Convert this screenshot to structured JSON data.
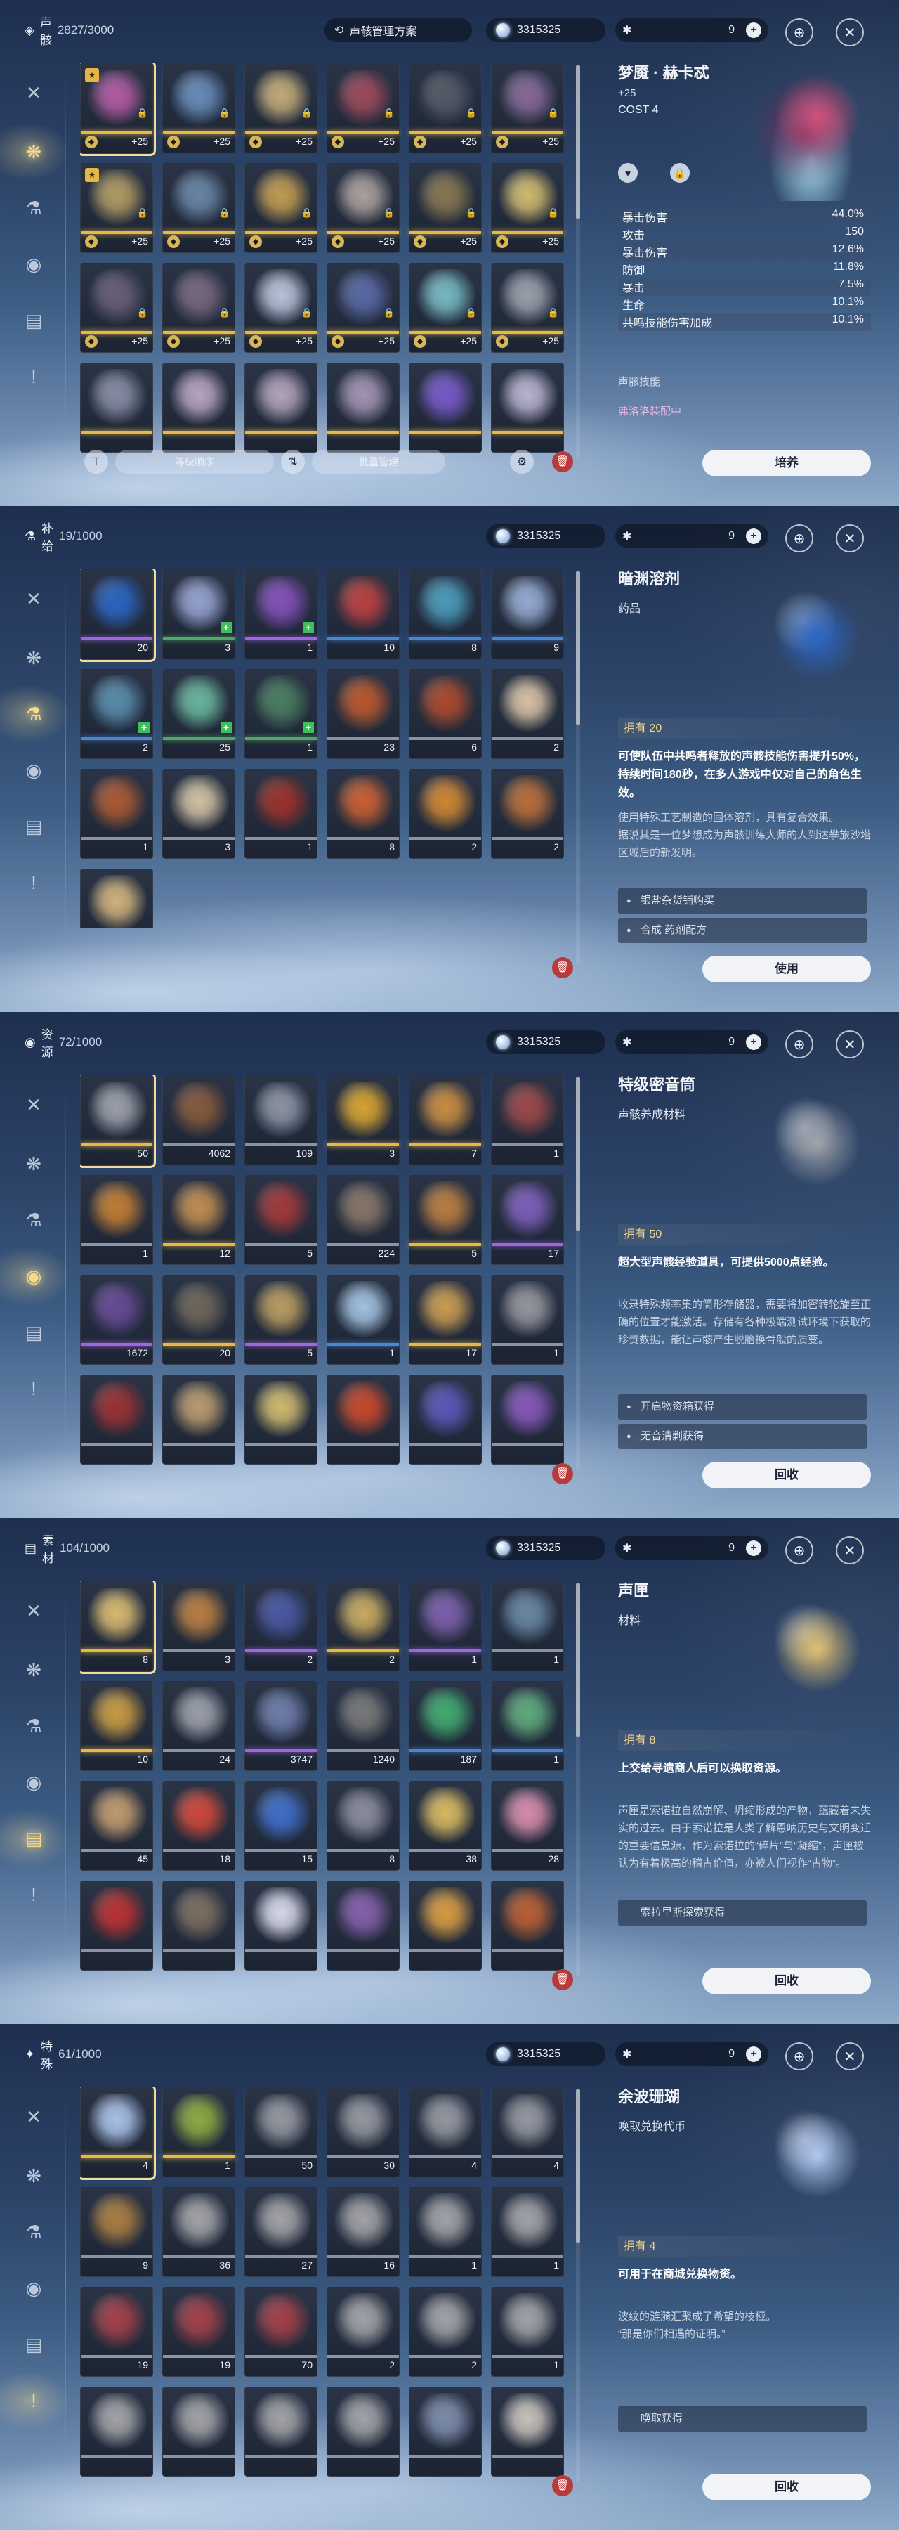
{
  "currency": "3315325",
  "stamina": "9",
  "panels": [
    {
      "cat_name": "声骸",
      "cat_count": "2827/3000",
      "cat_icon": "◈",
      "top_btn": "声骸管理方案",
      "sort_label": "等级顺序",
      "batch_label": "批量管理",
      "detail": {
        "name": "梦魇 · 赫卡忒",
        "level": "+25",
        "cost": "COST  4",
        "stats": [
          [
            "暴击伤害",
            "44.0%"
          ],
          [
            "攻击",
            "150"
          ],
          [
            "暴击伤害",
            "12.6%"
          ],
          [
            "防御",
            "11.8%"
          ],
          [
            "暴击",
            "7.5%"
          ],
          [
            "生命",
            "10.1%"
          ],
          [
            "共鸣技能伤害加成",
            "10.1%"
          ]
        ],
        "skill": "声骸技能",
        "set": "弗洛洛装配中",
        "button": "培养"
      },
      "items": [
        {
          "c": "4",
          "q": "q5",
          "b": "+25",
          "col": "#b85ca8"
        },
        {
          "c": "4",
          "q": "q5",
          "b": "+25",
          "col": "#6a8fbf"
        },
        {
          "c": "4",
          "q": "q5",
          "b": "+25",
          "col": "#c9b07a"
        },
        {
          "c": "4",
          "q": "q5",
          "b": "+25",
          "col": "#a04a5a"
        },
        {
          "c": "4",
          "q": "q5",
          "b": "+25",
          "col": "#555a66"
        },
        {
          "c": "4",
          "q": "q5",
          "b": "+25",
          "col": "#8a6a9a"
        },
        {
          "c": "4",
          "q": "q5",
          "b": "+25",
          "col": "#b8a064"
        },
        {
          "c": "4",
          "q": "q5",
          "b": "+25",
          "col": "#6a88a8"
        },
        {
          "c": "4",
          "q": "q5",
          "b": "+25",
          "col": "#c8a050"
        },
        {
          "c": "4",
          "q": "q5",
          "b": "+25",
          "col": "#b0a4a0"
        },
        {
          "c": "4",
          "q": "q5",
          "b": "+25",
          "col": "#8a7850"
        },
        {
          "c": "4",
          "q": "q5",
          "b": "+25",
          "col": "#d8c070"
        },
        {
          "c": "4",
          "q": "q5",
          "b": "+25",
          "col": "#6a6078"
        },
        {
          "c": "4",
          "q": "q5",
          "b": "+25",
          "col": "#7a6a80"
        },
        {
          "c": "4",
          "q": "q5",
          "b": "+25",
          "col": "#c0c8e0"
        },
        {
          "c": "4",
          "q": "q5",
          "b": "+25",
          "col": "#5a6aa8"
        },
        {
          "c": "4",
          "q": "q5",
          "b": "+25",
          "col": "#7ac0c8"
        },
        {
          "c": "4",
          "q": "q5",
          "b": "+25",
          "col": "#a0a4b0"
        },
        {
          "c": "",
          "q": "q5",
          "b": "",
          "col": "#8a90a8"
        },
        {
          "c": "",
          "q": "q5",
          "b": "",
          "col": "#c0a8c8"
        },
        {
          "c": "",
          "q": "q5",
          "b": "",
          "col": "#b8a8c0"
        },
        {
          "c": "",
          "q": "q5",
          "b": "",
          "col": "#a898b8"
        },
        {
          "c": "",
          "q": "q5",
          "b": "",
          "col": "#7a5ad0"
        },
        {
          "c": "",
          "q": "q5",
          "b": "",
          "col": "#c0b8d8"
        }
      ]
    },
    {
      "cat_name": "补给",
      "cat_count": "19/1000",
      "cat_icon": "⚗",
      "detail": {
        "name": "暗渊溶剂",
        "type": "药品",
        "own": "拥有 20",
        "desc1": "可使队伍中共鸣者释放的声骸技能伤害提升50%，持续时间180秒，在多人游戏中仅对自己的角色生效。",
        "desc2": "使用特殊工艺制造的固体溶剂，具有复合效果。\n据说其是一位梦想成为声骸训练大师的人到达攀旅沙塔区域后的新发明。",
        "sources": [
          "银盐杂货铺购买",
          "合成 药剂配方"
        ],
        "button": "使用"
      },
      "items": [
        {
          "c": "20",
          "q": "q4",
          "col": "#2a66c8"
        },
        {
          "c": "3",
          "q": "q2",
          "col": "#9aa8d8"
        },
        {
          "c": "1",
          "q": "q4",
          "col": "#8850c0"
        },
        {
          "c": "10",
          "q": "q3",
          "col": "#c04040"
        },
        {
          "c": "8",
          "q": "q3",
          "col": "#4aa0c0"
        },
        {
          "c": "9",
          "q": "q3",
          "col": "#9ab0d8"
        },
        {
          "c": "2",
          "q": "q3",
          "col": "#5a90b0"
        },
        {
          "c": "25",
          "q": "q2",
          "col": "#6abca0"
        },
        {
          "c": "1",
          "q": "q2",
          "col": "#4a8060"
        },
        {
          "c": "23",
          "q": "q1",
          "col": "#c0582a"
        },
        {
          "c": "6",
          "q": "q1",
          "col": "#b04a2a"
        },
        {
          "c": "2",
          "q": "q1",
          "col": "#e0c8a8"
        },
        {
          "c": "1",
          "q": "q1",
          "col": "#b05a30"
        },
        {
          "c": "3",
          "q": "q1",
          "col": "#d8c8a8"
        },
        {
          "c": "1",
          "q": "q1",
          "col": "#a03028"
        },
        {
          "c": "8",
          "q": "q1",
          "col": "#d06030"
        },
        {
          "c": "2",
          "q": "q1",
          "col": "#d88a30"
        },
        {
          "c": "2",
          "q": "q1",
          "col": "#c07038"
        },
        {
          "c": "",
          "q": "q1",
          "col": "#d8b880"
        }
      ]
    },
    {
      "cat_name": "资源",
      "cat_count": "72/1000",
      "cat_icon": "◉",
      "detail": {
        "name": "特级密音筒",
        "type": "声骸养成材料",
        "own": "拥有 50",
        "desc1": "超大型声骸经验道具，可提供5000点经验。",
        "desc2": "收录特殊频率集的筒形存储器，需要将加密转轮旋至正确的位置才能激活。存储有各种极端测试环境下获取的珍贵数据，能让声骸产生脱胎换骨般的质变。",
        "sources": [
          "开启物资箱获得",
          "无音清剿获得"
        ],
        "button": "回收"
      },
      "items": [
        {
          "c": "50",
          "q": "q5",
          "col": "#a0a4ac"
        },
        {
          "c": "4062",
          "q": "q1",
          "col": "#8a5a3a"
        },
        {
          "c": "109",
          "q": "q1",
          "col": "#9098a8"
        },
        {
          "c": "3",
          "q": "q5",
          "col": "#e0a830"
        },
        {
          "c": "7",
          "q": "q5",
          "col": "#d09040"
        },
        {
          "c": "1",
          "q": "q1",
          "col": "#a04848"
        },
        {
          "c": "1",
          "q": "q1",
          "col": "#c88030"
        },
        {
          "c": "12",
          "q": "q5",
          "col": "#c89050"
        },
        {
          "c": "5",
          "q": "q1",
          "col": "#a83838"
        },
        {
          "c": "224",
          "q": "q1",
          "col": "#8a7868"
        },
        {
          "c": "5",
          "q": "q5",
          "col": "#c08040"
        },
        {
          "c": "17",
          "q": "q4",
          "col": "#8060c0"
        },
        {
          "c": "1672",
          "q": "q4",
          "col": "#6a4a9a"
        },
        {
          "c": "20",
          "q": "q5",
          "col": "#706858"
        },
        {
          "c": "5",
          "q": "q4",
          "col": "#c0a060"
        },
        {
          "c": "1",
          "q": "q3",
          "col": "#a8c8e8"
        },
        {
          "c": "17",
          "q": "q5",
          "col": "#d0a050"
        },
        {
          "c": "1",
          "q": "q1",
          "col": "#9a9aa0"
        },
        {
          "c": "",
          "q": "q1",
          "col": "#a03030"
        },
        {
          "c": "",
          "q": "q1",
          "col": "#c0a070"
        },
        {
          "c": "",
          "q": "q1",
          "col": "#d8c070"
        },
        {
          "c": "",
          "q": "q1",
          "col": "#d04828"
        },
        {
          "c": "",
          "q": "q1",
          "col": "#5a58c0"
        },
        {
          "c": "",
          "q": "q1",
          "col": "#8a58c0"
        }
      ]
    },
    {
      "cat_name": "素材",
      "cat_count": "104/1000",
      "cat_icon": "▤",
      "detail": {
        "name": "声匣",
        "type": "材料",
        "own": "拥有 8",
        "desc1": "上交给寻遗商人后可以换取资源。",
        "desc2": "声匣是索诺拉自然崩解、坍缩形成的产物，蕴藏着未失实的过去。由于索诺拉是人类了解恩呐历史与文明变迁的重要信息源，作为索诺拉的“碎片”与“凝缩”，声匣被认为有着极高的稽古价值，亦被人们视作“古物”。",
        "sources": [
          "索拉里斯探索获得"
        ],
        "button": "回收"
      },
      "items": [
        {
          "c": "8",
          "q": "q5",
          "col": "#e0c070"
        },
        {
          "c": "3",
          "q": "q1",
          "col": "#c08040"
        },
        {
          "c": "2",
          "q": "q4",
          "col": "#4a58a8"
        },
        {
          "c": "2",
          "q": "q5",
          "col": "#d0b060"
        },
        {
          "c": "1",
          "q": "q4",
          "col": "#8060b0"
        },
        {
          "c": "1",
          "q": "q1",
          "col": "#6a8aa8"
        },
        {
          "c": "10",
          "q": "q5",
          "col": "#d0a040"
        },
        {
          "c": "24",
          "q": "q1",
          "col": "#a0a4ac"
        },
        {
          "c": "3747",
          "q": "q4",
          "col": "#7080b0"
        },
        {
          "c": "1240",
          "q": "q1",
          "col": "#7a7a7a"
        },
        {
          "c": "187",
          "q": "q3",
          "col": "#40b070"
        },
        {
          "c": "1",
          "q": "q3",
          "col": "#60b080"
        },
        {
          "c": "45",
          "q": "q1",
          "col": "#c8a070"
        },
        {
          "c": "18",
          "q": "q1",
          "col": "#d84838"
        },
        {
          "c": "15",
          "q": "q1",
          "col": "#4070d0"
        },
        {
          "c": "8",
          "q": "q1",
          "col": "#9090a0"
        },
        {
          "c": "38",
          "q": "q1",
          "col": "#e0c060"
        },
        {
          "c": "28",
          "q": "q1",
          "col": "#e090b0"
        },
        {
          "c": "",
          "q": "q1",
          "col": "#c03030"
        },
        {
          "c": "",
          "q": "q1",
          "col": "#807060"
        },
        {
          "c": "",
          "q": "q1",
          "col": "#e0e0f0"
        },
        {
          "c": "",
          "q": "q1",
          "col": "#8a60b0"
        },
        {
          "c": "",
          "q": "q1",
          "col": "#e0a040"
        },
        {
          "c": "",
          "q": "q1",
          "col": "#c06030"
        }
      ]
    },
    {
      "cat_name": "特殊",
      "cat_count": "61/1000",
      "cat_icon": "✦",
      "detail": {
        "name": "余波珊瑚",
        "type": "唤取兑换代币",
        "own": "拥有 4",
        "desc1": "可用于在商城兑换物资。",
        "desc2": "波纹的涟漪汇聚成了希望的枝桠。\n“那是你们相遇的证明。”",
        "sources": [
          "唤取获得"
        ],
        "button": "回收"
      },
      "items": [
        {
          "c": "4",
          "q": "q5",
          "col": "#b0c8f0"
        },
        {
          "c": "1",
          "q": "q5",
          "col": "#90b040"
        },
        {
          "c": "50",
          "q": "q1",
          "col": "#9a9ca4"
        },
        {
          "c": "30",
          "q": "q1",
          "col": "#9a9ca4"
        },
        {
          "c": "4",
          "q": "q1",
          "col": "#9a9ca4"
        },
        {
          "c": "4",
          "q": "q1",
          "col": "#9a9ca4"
        },
        {
          "c": "9",
          "q": "q1",
          "col": "#b08040"
        },
        {
          "c": "36",
          "q": "q1",
          "col": "#a8a8ac"
        },
        {
          "c": "27",
          "q": "q1",
          "col": "#a8a8ac"
        },
        {
          "c": "16",
          "q": "q1",
          "col": "#a8a8ac"
        },
        {
          "c": "1",
          "q": "q1",
          "col": "#a8a8ac"
        },
        {
          "c": "1",
          "q": "q1",
          "col": "#a8a8ac"
        },
        {
          "c": "19",
          "q": "q1",
          "col": "#a84048"
        },
        {
          "c": "19",
          "q": "q1",
          "col": "#a84048"
        },
        {
          "c": "70",
          "q": "q1",
          "col": "#a84048"
        },
        {
          "c": "2",
          "q": "q1",
          "col": "#a8a8ac"
        },
        {
          "c": "2",
          "q": "q1",
          "col": "#a8a8ac"
        },
        {
          "c": "1",
          "q": "q1",
          "col": "#a8a8ac"
        },
        {
          "c": "",
          "q": "q1",
          "col": "#a8a8ac"
        },
        {
          "c": "",
          "q": "q1",
          "col": "#a8a8ac"
        },
        {
          "c": "",
          "q": "q1",
          "col": "#a8a8ac"
        },
        {
          "c": "",
          "q": "q1",
          "col": "#a8a8ac"
        },
        {
          "c": "",
          "q": "q1",
          "col": "#8090b0"
        },
        {
          "c": "",
          "q": "q1",
          "col": "#d0c8c0"
        }
      ]
    }
  ],
  "sidebar_icons": [
    "swords-icon",
    "echo-icon",
    "supply-icon",
    "resource-icon",
    "material-icon",
    "special-icon"
  ]
}
